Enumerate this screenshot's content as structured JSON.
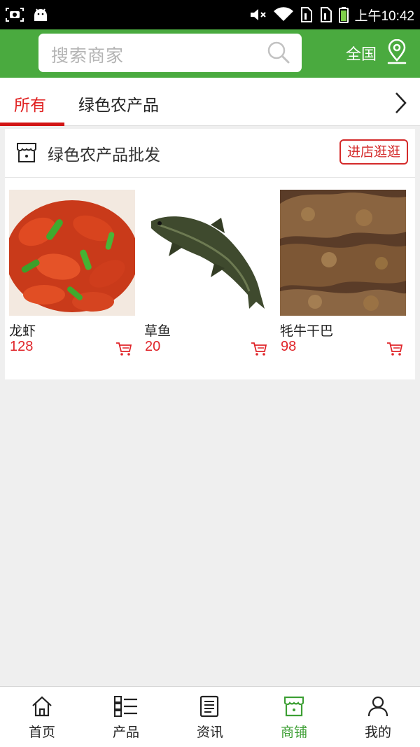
{
  "status_bar": {
    "time": "上午10:42"
  },
  "header": {
    "search_placeholder": "搜索商家",
    "region": "全国"
  },
  "tabs": [
    {
      "label": "所有",
      "active": true
    },
    {
      "label": "绿色农产品",
      "active": false
    }
  ],
  "shop": {
    "name": "绿色农产品批发",
    "enter_label": "进店逛逛",
    "products": [
      {
        "name": "龙虾",
        "price": "128"
      },
      {
        "name": "草鱼",
        "price": "20"
      },
      {
        "name": "牦牛干巴",
        "price": "98"
      }
    ]
  },
  "bottom_nav": [
    {
      "label": "首页",
      "icon": "home-icon",
      "active": false
    },
    {
      "label": "产品",
      "icon": "grid-list-icon",
      "active": false
    },
    {
      "label": "资讯",
      "icon": "news-icon",
      "active": false
    },
    {
      "label": "商铺",
      "icon": "store-icon",
      "active": true
    },
    {
      "label": "我的",
      "icon": "user-icon",
      "active": false
    }
  ],
  "colors": {
    "brand_green": "#4aaa3f",
    "accent_red": "#e0252a",
    "active_nav_green": "#3d9f34"
  }
}
